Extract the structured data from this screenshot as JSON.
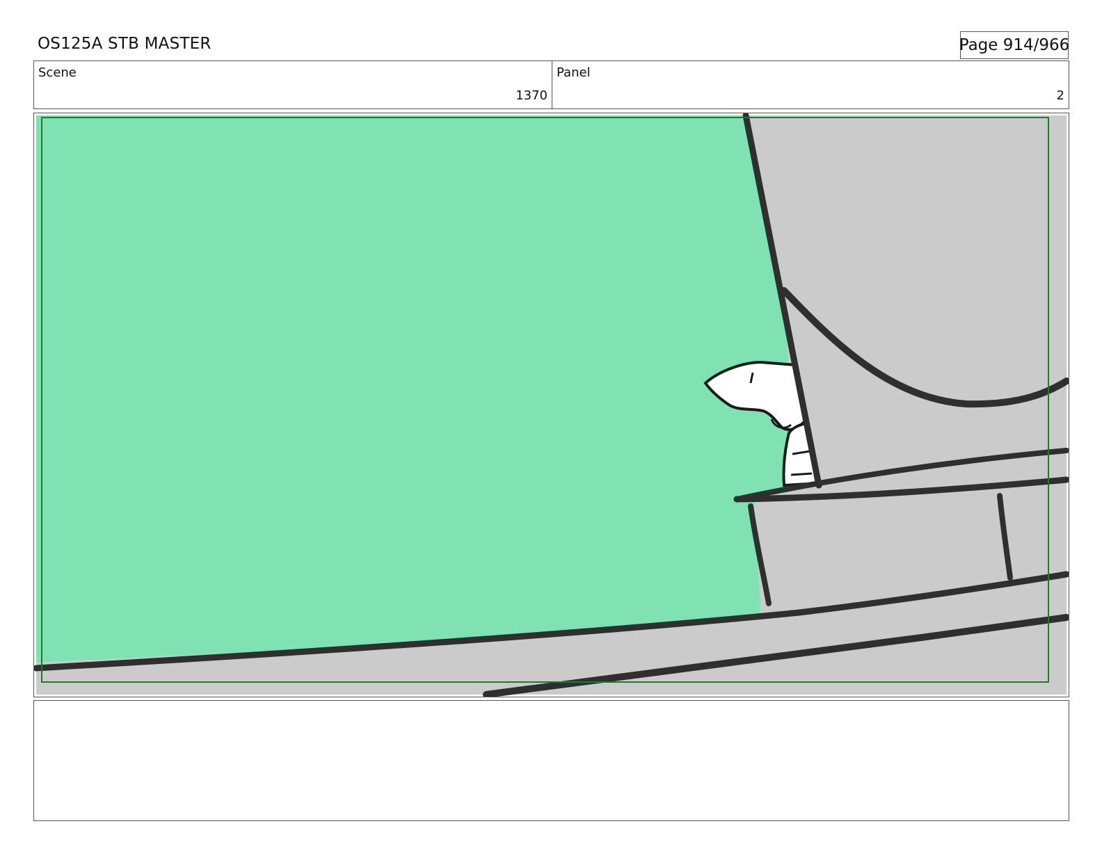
{
  "header": {
    "title": "OS125A STB MASTER",
    "page": "Page 914/966"
  },
  "info": {
    "scene_label": "Scene",
    "scene_value": "1370",
    "panel_label": "Panel",
    "panel_value": "2"
  },
  "frame": {
    "sky_color": "#80e2b2",
    "structure_color": "#cbcbcb",
    "line_color": "#2f2f2f",
    "safe_area_color": "#1f7a2a"
  },
  "notes": {
    "text": ""
  }
}
